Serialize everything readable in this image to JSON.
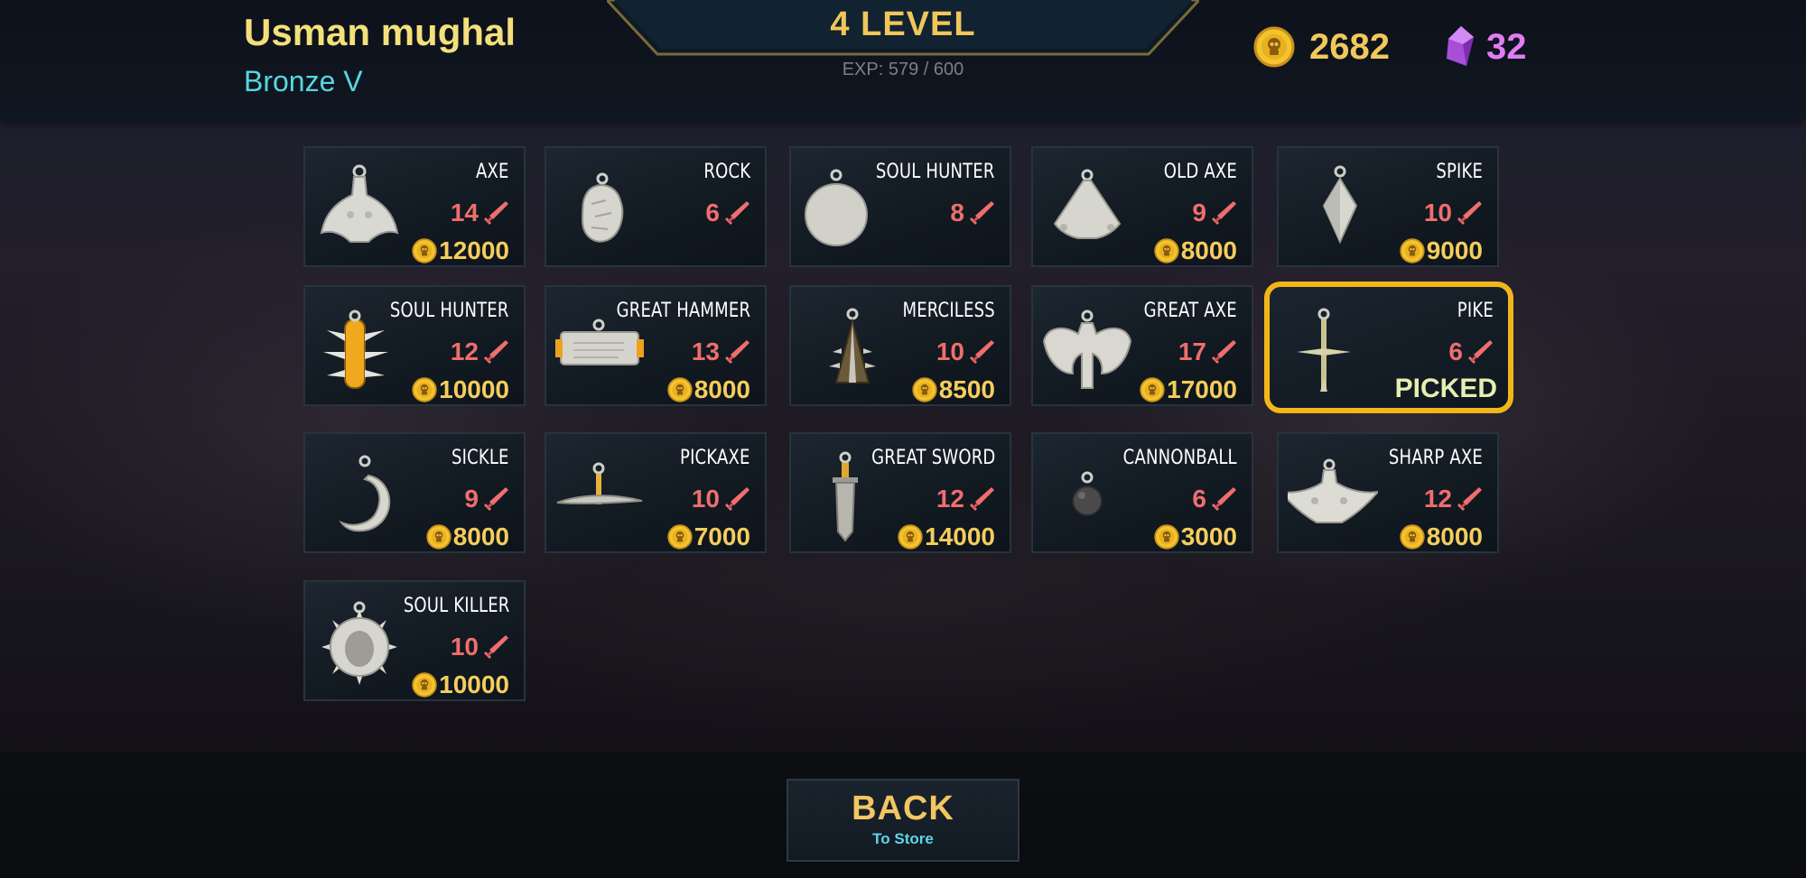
{
  "player": {
    "name": "Usman mughal",
    "rank": "Bronze V"
  },
  "level": {
    "label": "4  LEVEL",
    "exp": "EXP: 579 / 600"
  },
  "currency": {
    "gold": "2682",
    "gems": "32"
  },
  "colors": {
    "gold": "#f4cd5c",
    "damage": "#ef6e6e",
    "picked_border": "#f3b619",
    "rank": "#56d8e0"
  },
  "weapons": [
    {
      "name": "AXE",
      "damage": "14",
      "price": "12000",
      "icon": "axe-icon"
    },
    {
      "name": "ROCK",
      "damage": "6",
      "price": "",
      "icon": "rock-icon"
    },
    {
      "name": "SOUL HUNTER",
      "damage": "8",
      "price": "",
      "icon": "round-pendant-icon"
    },
    {
      "name": "OLD AXE",
      "damage": "9",
      "price": "8000",
      "icon": "old-axe-icon"
    },
    {
      "name": "SPIKE",
      "damage": "10",
      "price": "9000",
      "icon": "spike-icon"
    },
    {
      "name": "SOUL HUNTER",
      "damage": "12",
      "price": "10000",
      "icon": "spiked-club-icon"
    },
    {
      "name": "GREAT HAMMER",
      "damage": "13",
      "price": "8000",
      "icon": "hammer-icon"
    },
    {
      "name": "MERCILESS",
      "damage": "10",
      "price": "8500",
      "icon": "merciless-icon"
    },
    {
      "name": "GREAT AXE",
      "damage": "17",
      "price": "17000",
      "icon": "great-axe-icon"
    },
    {
      "name": "PIKE",
      "damage": "6",
      "price": "",
      "status": "PICKED",
      "icon": "pike-icon"
    },
    {
      "name": "SICKLE",
      "damage": "9",
      "price": "8000",
      "icon": "sickle-icon"
    },
    {
      "name": "PICKAXE",
      "damage": "10",
      "price": "7000",
      "icon": "pickaxe-icon"
    },
    {
      "name": "GREAT SWORD",
      "damage": "12",
      "price": "14000",
      "icon": "sword-icon"
    },
    {
      "name": "CANNONBALL",
      "damage": "6",
      "price": "3000",
      "icon": "cannonball-icon"
    },
    {
      "name": "SHARP AXE",
      "damage": "12",
      "price": "8000",
      "icon": "sharp-axe-icon"
    },
    {
      "name": "SOUL KILLER",
      "damage": "10",
      "price": "10000",
      "icon": "spiked-orb-icon"
    }
  ],
  "back_button": {
    "title": "BACK",
    "subtitle": "To Store"
  }
}
